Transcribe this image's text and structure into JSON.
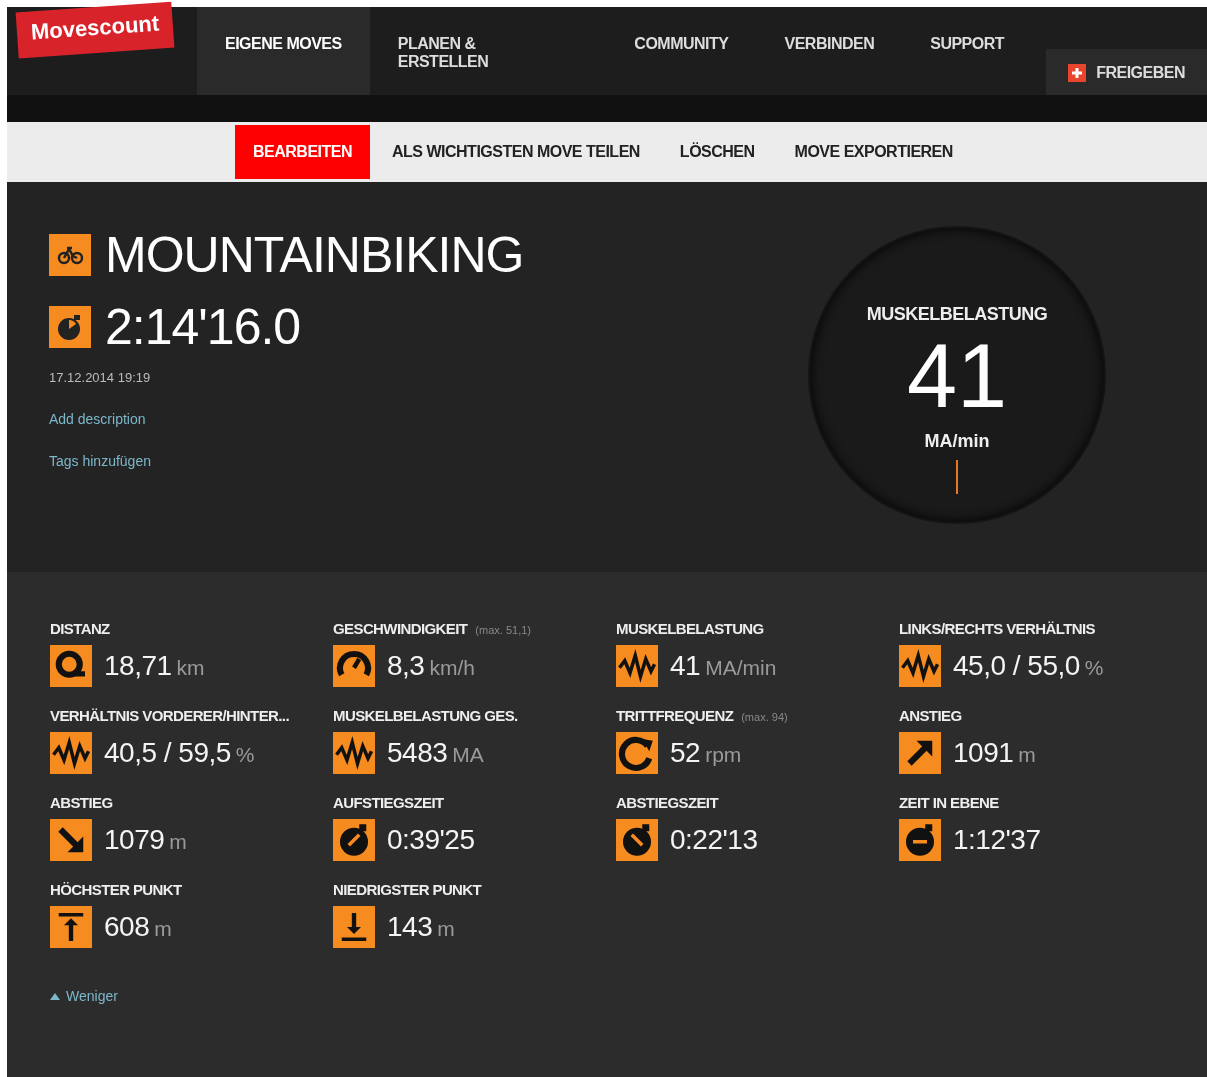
{
  "logo": "Movescount",
  "nav": [
    {
      "label": "EIGENE MOVES",
      "selected": true
    },
    {
      "label": "PLANEN &\nERSTELLEN",
      "selected": false
    },
    {
      "label": "COMMUNITY",
      "selected": false
    },
    {
      "label": "VERBINDEN",
      "selected": false
    },
    {
      "label": "SUPPORT",
      "selected": false
    }
  ],
  "share_button": "FREIGEBEN",
  "actions": [
    {
      "label": "BEARBEITEN",
      "selected": true
    },
    {
      "label": "ALS WICHTIGSTEN MOVE TEILEN",
      "selected": false
    },
    {
      "label": "LÖSCHEN",
      "selected": false
    },
    {
      "label": "MOVE EXPORTIEREN",
      "selected": false
    }
  ],
  "move": {
    "sport": "MOUNTAINBIKING",
    "duration": "2:14'16.0",
    "date": "17.12.2014 19:19",
    "add_description": "Add description",
    "add_tags": "Tags hinzufügen"
  },
  "gauge": {
    "title": "MUSKELBELASTUNG",
    "value": "41",
    "unit": "MA/min"
  },
  "stats": [
    {
      "label": "DISTANZ",
      "kind": "distance",
      "value": "18,71",
      "unit": "km"
    },
    {
      "label": "GESCHWINDIGKEIT",
      "note": "(max. 51,1)",
      "kind": "speed",
      "value": "8,3",
      "unit": "km/h"
    },
    {
      "label": "MUSKELBELASTUNG",
      "kind": "wave",
      "value": "41",
      "unit": "MA/min"
    },
    {
      "label": "LINKS/RECHTS VERHÄLTNIS",
      "kind": "wave",
      "value": "45,0 / 55,0",
      "unit": "%"
    },
    {
      "label": "VERHÄLTNIS VORDERER/HINTER...",
      "kind": "wave",
      "value": "40,5 / 59,5",
      "unit": "%"
    },
    {
      "label": "MUSKELBELASTUNG GES.",
      "kind": "wave",
      "value": "5483",
      "unit": "MA"
    },
    {
      "label": "TRITTFREQUENZ",
      "note": "(max. 94)",
      "kind": "cadence",
      "value": "52",
      "unit": "rpm"
    },
    {
      "label": "ANSTIEG",
      "kind": "ascent",
      "value": "1091",
      "unit": "m"
    },
    {
      "label": "ABSTIEG",
      "kind": "descent",
      "value": "1079",
      "unit": "m"
    },
    {
      "label": "AUFSTIEGSZEIT",
      "kind": "ascent_time",
      "value": "0:39'25"
    },
    {
      "label": "ABSTIEGSZEIT",
      "kind": "descent_time",
      "value": "0:22'13"
    },
    {
      "label": "ZEIT IN EBENE",
      "kind": "flat_time",
      "value": "1:12'37"
    },
    {
      "label": "HÖCHSTER PUNKT",
      "kind": "highest",
      "value": "608",
      "unit": "m"
    },
    {
      "label": "NIEDRIGSTER PUNKT",
      "kind": "lowest",
      "value": "143",
      "unit": "m"
    }
  ],
  "less_link": "Weniger"
}
